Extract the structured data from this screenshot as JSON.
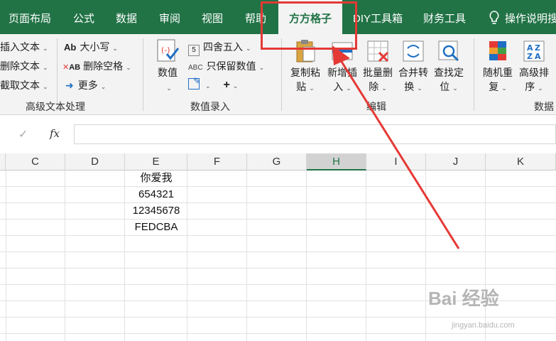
{
  "tabs": [
    {
      "label": "页面布局"
    },
    {
      "label": "公式"
    },
    {
      "label": "数据"
    },
    {
      "label": "审阅"
    },
    {
      "label": "视图"
    },
    {
      "label": "帮助"
    },
    {
      "label": "方方格子",
      "active": true
    },
    {
      "label": "DIY工具箱"
    },
    {
      "label": "财务工具"
    }
  ],
  "help": {
    "label": "操作说明搜"
  },
  "ribbon": {
    "text_group": {
      "items": [
        "插入文本",
        "删除文本",
        "截取文本"
      ],
      "case_label": "大小写",
      "remove_space_label": "删除空格",
      "more_label": "更多",
      "group_label": "高级文本处理"
    },
    "value_group": {
      "value_btn_label": "数值",
      "round_label": "四舍五入",
      "keep_value_label": "只保留数值",
      "group_label": "数值录入"
    },
    "edit_group": {
      "copy_label_1": "复制粘",
      "copy_label_2": "贴",
      "insert_label_1": "新增插",
      "insert_label_2": "入",
      "batch_delete_label_1": "批量删",
      "batch_delete_label_2": "除",
      "merge_label_1": "合并转",
      "merge_label_2": "换",
      "find_label_1": "查找定",
      "find_label_2": "位",
      "group_label": "编辑"
    },
    "data_group": {
      "random_label_1": "随机重",
      "random_label_2": "复",
      "sort_label_1": "高级排",
      "sort_label_2": "序",
      "group_label": "数据"
    }
  },
  "formula_bar": {
    "fx": "fx",
    "check": "✓"
  },
  "columns": [
    "C",
    "D",
    "E",
    "F",
    "G",
    "H",
    "I",
    "J",
    "K"
  ],
  "selected_column": "H",
  "cells": [
    "你爱我",
    "654321",
    "12345678",
    "FEDCBA"
  ],
  "watermark": {
    "text": "Bai 经验",
    "sub": "jingyan.baidu.com"
  },
  "colors": {
    "excel_green": "#217346",
    "highlight_red": "#e53935"
  }
}
